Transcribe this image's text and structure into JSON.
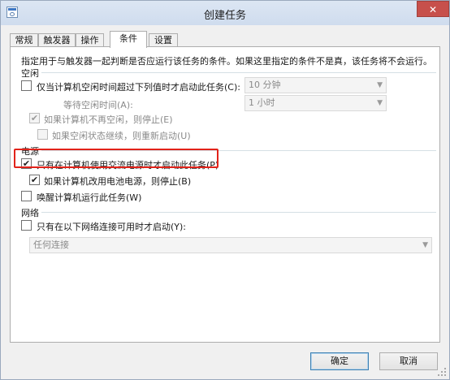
{
  "window": {
    "title": "创建任务",
    "close_label": "✕"
  },
  "tabs": [
    {
      "label": "常规"
    },
    {
      "label": "触发器"
    },
    {
      "label": "操作"
    },
    {
      "label": "条件"
    },
    {
      "label": "设置"
    }
  ],
  "description": "指定用于与触发器一起判断是否应运行该任务的条件。如果这里指定的条件不是真，该任务将不会运行。",
  "idle": {
    "heading": "空闲",
    "start_if_idle_label": "仅当计算机空闲时间超过下列值时才启动此任务(C):",
    "idle_duration_value": "10 分钟",
    "wait_label": "等待空闲时间(A):",
    "wait_value": "1 小时",
    "stop_if_not_idle_label": "如果计算机不再空闲，则停止(E)",
    "restart_label": "如果空闲状态继续，则重新启动(U)"
  },
  "power": {
    "heading": "电源",
    "ac_only_label": "只有在计算机使用交流电源时才启动此任务(P)",
    "stop_on_battery_label": "如果计算机改用电池电源，则停止(B)",
    "wake_label": "唤醒计算机运行此任务(W)"
  },
  "network": {
    "heading": "网络",
    "start_if_network_label": "只有在以下网络连接可用时才启动(Y):",
    "connection_value": "任何连接"
  },
  "buttons": {
    "ok": "确定",
    "cancel": "取消"
  },
  "checks": {
    "checked_glyph": "✔"
  }
}
